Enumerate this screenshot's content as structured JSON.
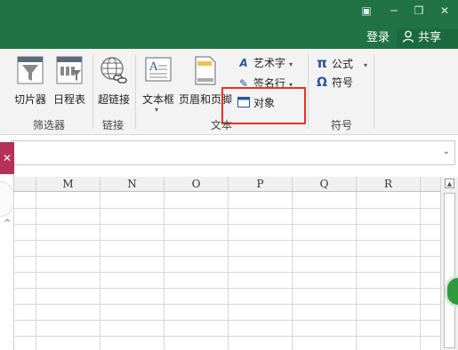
{
  "titlebar": {
    "help_glyph": "▣",
    "minimize_glyph": "─",
    "restore_glyph": "❐",
    "close_glyph": "✕",
    "login_label": "登录",
    "share_label": "共享",
    "share_icon": "person-icon"
  },
  "ribbon": {
    "groups": {
      "filters": "筛选器",
      "links": "链接",
      "text": "文本",
      "symbols": "符号"
    },
    "buttons": {
      "slicer": "切片器",
      "timeline": "日程表",
      "hyperlink": "超链接",
      "textbox": "文本框",
      "header_footer": "页眉和页脚",
      "wordart": "艺术字",
      "signature_line": "签名行",
      "object": "对象",
      "equation": "公式",
      "symbol": "符号"
    },
    "icons": {
      "wordart": "A",
      "equation": "π",
      "symbol": "Ω"
    },
    "highlight_color": "#e8312a"
  },
  "formula_bar": {
    "value": "",
    "expand_glyph": "⌄"
  },
  "left_panel": {
    "close_glyph": "✕",
    "caret_glyph": "^",
    "accent_color": "#b6305a"
  },
  "sheet": {
    "columns": [
      "M",
      "N",
      "O",
      "P",
      "Q",
      "R"
    ]
  },
  "colors": {
    "title_green": "#217346",
    "ribbon_bg": "#f3f3f3"
  }
}
